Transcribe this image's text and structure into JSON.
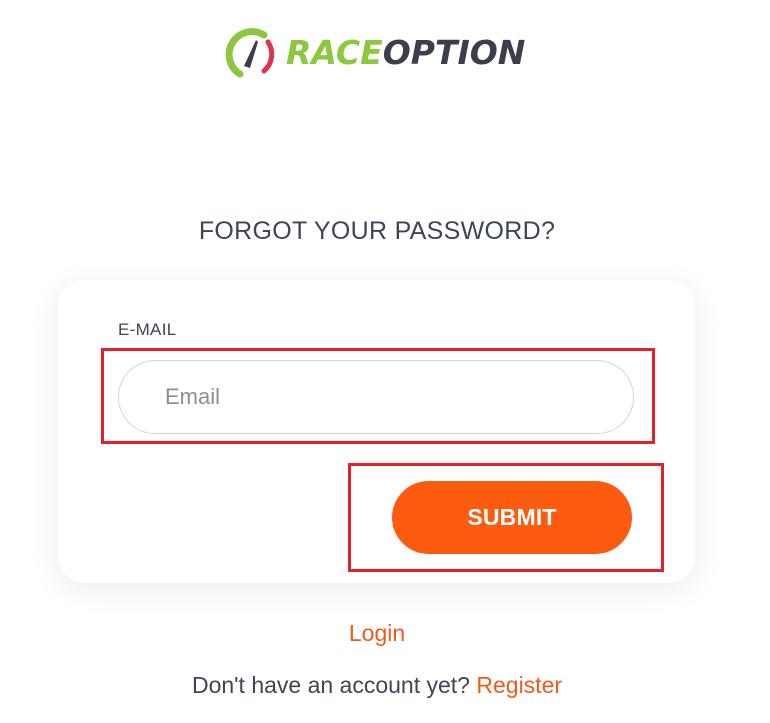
{
  "logo": {
    "text_part1": "RACE",
    "text_part2": "OPTION",
    "icon": "speedometer-gauge-icon",
    "color_green": "#8dc63f",
    "color_dark": "#3a3f4b",
    "color_red": "#e0324a"
  },
  "page": {
    "title": "FORGOT YOUR PASSWORD?"
  },
  "form": {
    "email_label": "E-MAIL",
    "email_placeholder": "Email",
    "email_value": "",
    "submit_label": "SUBMIT"
  },
  "footer": {
    "login_link": "Login",
    "register_prompt": "Don't have an account yet?",
    "register_link": "Register"
  },
  "colors": {
    "accent": "#fd5c10",
    "link": "#f05a1c",
    "text": "#3d4654",
    "highlight": "#e3212d"
  }
}
